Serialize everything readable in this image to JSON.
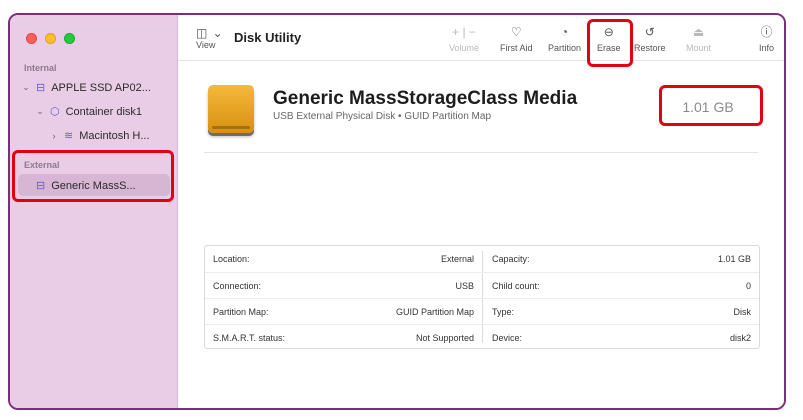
{
  "window": {
    "app_title": "Disk Utility"
  },
  "toolbar": {
    "view_label": "View",
    "volume_label": "Volume",
    "first_aid_label": "First Aid",
    "partition_label": "Partition",
    "erase_label": "Erase",
    "restore_label": "Restore",
    "mount_label": "Mount",
    "info_label": "Info"
  },
  "sidebar": {
    "internal_label": "Internal",
    "external_label": "External",
    "items": [
      {
        "label": "APPLE SSD AP02..."
      },
      {
        "label": "Container disk1"
      },
      {
        "label": "Macintosh H..."
      },
      {
        "label": "Generic MassS..."
      }
    ]
  },
  "disk": {
    "name": "Generic MassStorageClass Media",
    "subtitle": "USB External Physical Disk • GUID Partition Map",
    "size": "1.01 GB"
  },
  "info": {
    "left": [
      {
        "label": "Location:",
        "value": "External"
      },
      {
        "label": "Connection:",
        "value": "USB"
      },
      {
        "label": "Partition Map:",
        "value": "GUID Partition Map"
      },
      {
        "label": "S.M.A.R.T. status:",
        "value": "Not Supported"
      }
    ],
    "right": [
      {
        "label": "Capacity:",
        "value": "1.01 GB"
      },
      {
        "label": "Child count:",
        "value": "0"
      },
      {
        "label": "Type:",
        "value": "Disk"
      },
      {
        "label": "Device:",
        "value": "disk2"
      }
    ]
  },
  "colors": {
    "sidebar_bg": "#e9cde6",
    "highlight": "#e3000f",
    "accent": "#6a5bd6",
    "drive_icon": "#f0a92a"
  }
}
